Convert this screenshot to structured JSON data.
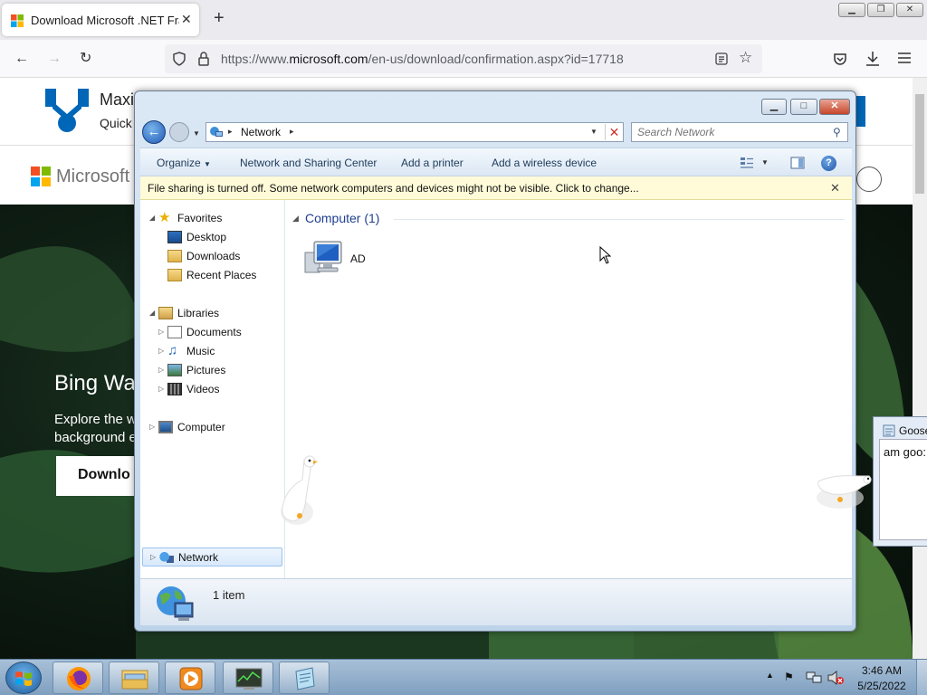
{
  "browser": {
    "tab_title": "Download Microsoft .NET Fram",
    "tab_close": "✕",
    "new_tab": "+",
    "url_prefix": "https://www.",
    "url_domain": "microsoft.com",
    "url_path": "/en-us/download/confirmation.aspx?id=17718",
    "window_controls": {
      "minimize": "▁",
      "maximize": "❐",
      "close": "✕"
    }
  },
  "webpage": {
    "banner_title": "Maxi",
    "banner_subtitle": "Quick",
    "logo_text": "Microsoft",
    "hero_title": "Bing Wal",
    "hero_description": "Explore the w background e",
    "hero_button": "Downlo"
  },
  "explorer": {
    "address_path": "Network",
    "address_chevron": "▸",
    "search_placeholder": "Search Network",
    "window_controls": {
      "minimize": "▁",
      "maximize": "□",
      "close": "✕"
    },
    "commands": [
      "Organize",
      "Network and Sharing Center",
      "Add a printer",
      "Add a wireless device"
    ],
    "infobar": "File sharing is turned off. Some network computers and devices might not be visible. Click to change...",
    "infobar_close": "✕",
    "nav": {
      "favorites": "Favorites",
      "desktop": "Desktop",
      "downloads": "Downloads",
      "recent_places": "Recent Places",
      "libraries": "Libraries",
      "documents": "Documents",
      "music": "Music",
      "pictures": "Pictures",
      "videos": "Videos",
      "computer": "Computer",
      "network": "Network"
    },
    "group_header": "Computer (1)",
    "items": [
      {
        "name": "AD",
        "icon": "computer-icon"
      }
    ],
    "details": "1 item"
  },
  "notepad": {
    "title": "Goose",
    "text": "am goo:"
  },
  "taskbar": {
    "apps": [
      "start-orb",
      "firefox-icon",
      "explorer-icon",
      "media-player-icon",
      "task-manager-icon",
      "notepad-icon"
    ],
    "time": "3:46 AM",
    "date": "5/25/2022"
  },
  "colors": {
    "ms_blue": "#0067b8",
    "explorer_frame": "#bdd3ea",
    "infobar_bg": "#fffbd8",
    "taskbar": "#8fb0cf"
  }
}
